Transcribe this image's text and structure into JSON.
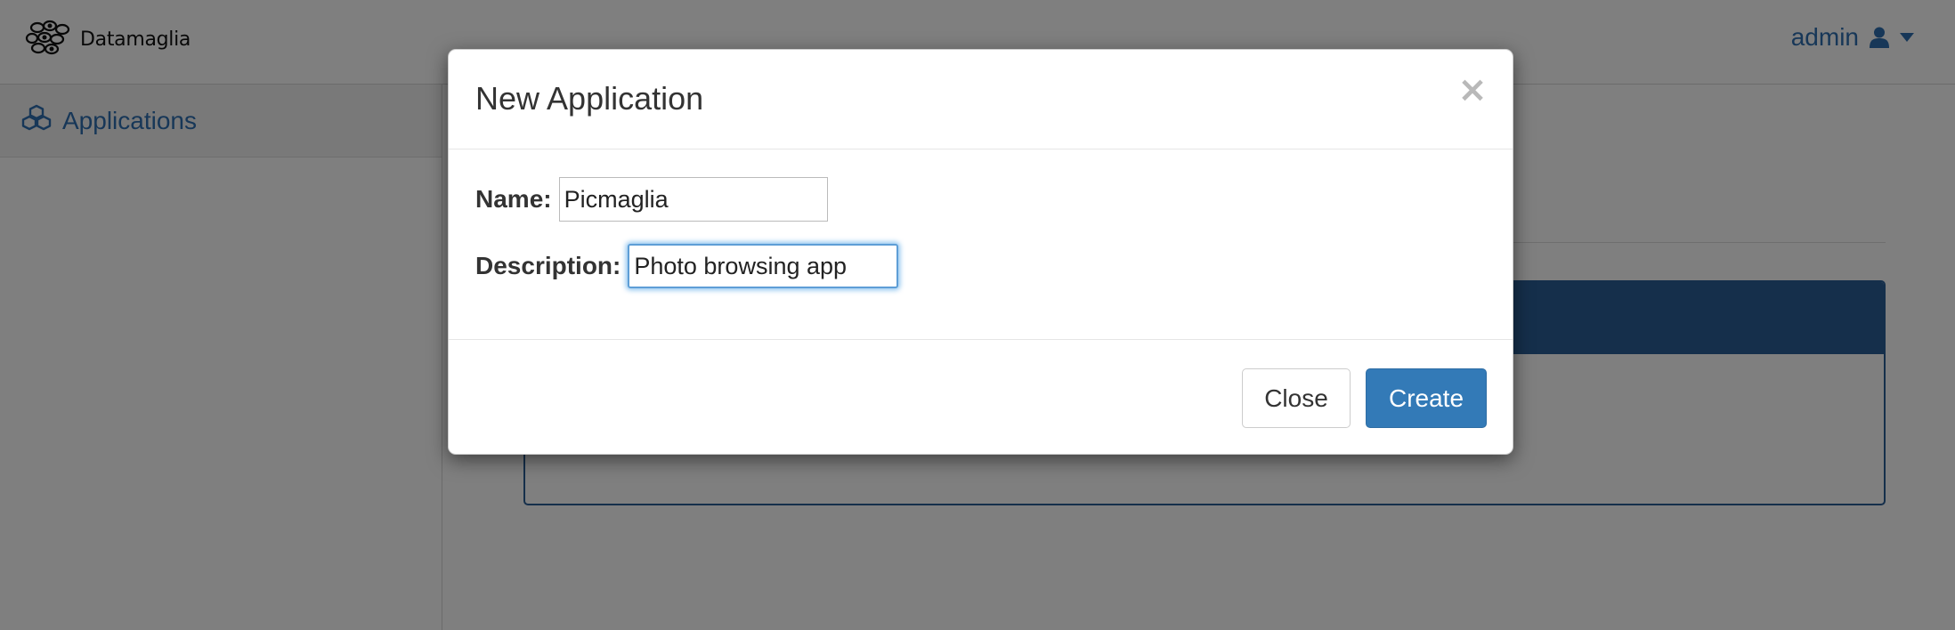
{
  "navbar": {
    "brand_name": "Datamaglia",
    "user_name": "admin",
    "user_icon": "user-icon",
    "caret_icon": "caret-down-icon"
  },
  "sidebar": {
    "items": [
      {
        "label": "Applications",
        "icon": "cubes-icon"
      }
    ]
  },
  "modal": {
    "title": "New Application",
    "close_symbol": "×",
    "fields": {
      "name": {
        "label": "Name:",
        "value": "Picmaglia"
      },
      "description": {
        "label": "Description:",
        "value": "Photo browsing app"
      }
    },
    "buttons": {
      "close_label": "Close",
      "create_label": "Create"
    }
  },
  "colors": {
    "accent": "#337ab7",
    "link": "#2f6fb0",
    "panel_header": "#2b5f96"
  }
}
